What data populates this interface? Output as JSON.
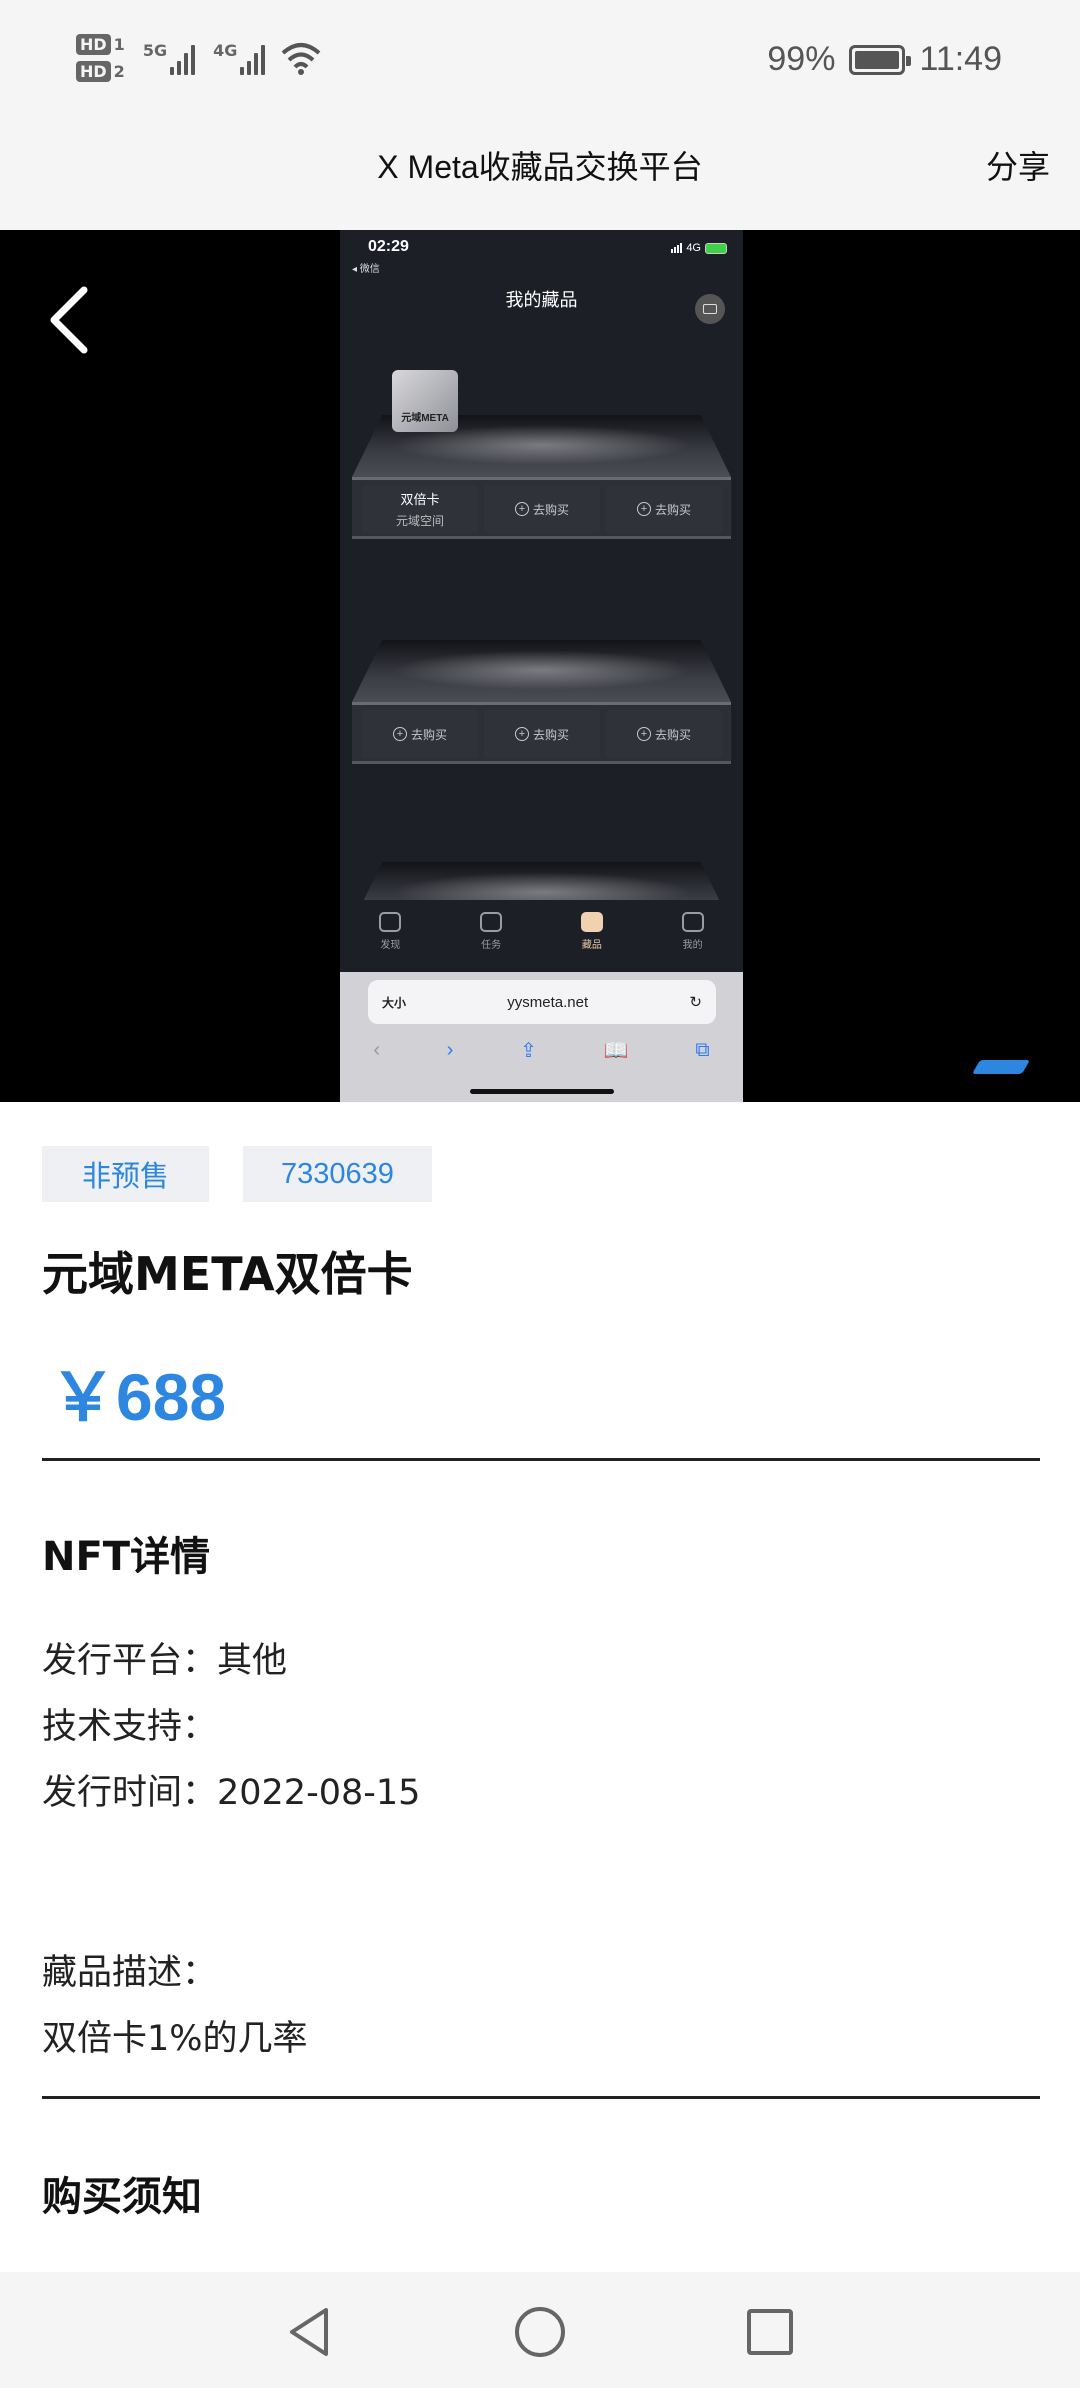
{
  "status_bar": {
    "hd1": "HD",
    "hd1_num": "1",
    "hd2": "HD",
    "hd2_num": "2",
    "net1": "5G",
    "net2": "4G",
    "battery": "99%",
    "battery_level": 0.99,
    "time": "11:49",
    "icons": [
      "signal-icon",
      "wifi-icon",
      "battery-icon"
    ]
  },
  "app_bar": {
    "title": "X Meta收藏品交换平台",
    "share": "分享",
    "back_icon": "chevron-left-icon"
  },
  "media": {
    "phone_time": "02:29",
    "phone_back_label": "◂ 微信",
    "phone_network": "4G",
    "phone_title": "我的藏品",
    "item_card_label": "元域META",
    "shelf1": {
      "item_name": "双倍卡",
      "item_sub": "元域空间",
      "buy1": "去购买",
      "buy2": "去购买"
    },
    "shelf2": {
      "buy1": "去购买",
      "buy2": "去购买",
      "buy3": "去购买"
    },
    "tabs": [
      "发现",
      "任务",
      "藏品",
      "我的"
    ],
    "browser_aa": "大小",
    "browser_url": "yysmeta.net",
    "browser_tools": [
      "‹",
      "›",
      "⇪",
      "📖",
      "⧉"
    ]
  },
  "product": {
    "tag_presale": "非预售",
    "tag_id": "7330639",
    "title": "元域META双倍卡",
    "price": "￥688"
  },
  "nft_details": {
    "heading": "NFT详情",
    "platform": "发行平台：其他",
    "tech": "技术支持：",
    "date": "发行时间：2022-08-15",
    "desc_label": "藏品描述：",
    "desc_value": "双倍卡1%的几率"
  },
  "purchase": {
    "heading": "购买须知"
  },
  "nav_bar": {
    "icons": [
      "back-triangle-icon",
      "home-circle-icon",
      "recents-square-icon"
    ]
  },
  "colors": {
    "accent": "#2d86e0",
    "tag_bg": "#eef0f3",
    "bar_bg": "#f5f5f5"
  }
}
